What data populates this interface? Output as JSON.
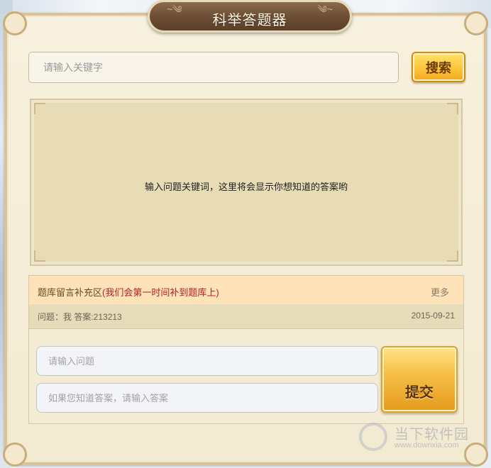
{
  "window": {
    "title": "科举答题器"
  },
  "search": {
    "placeholder": "请输入关键字",
    "button_label": "搜索"
  },
  "answer_panel": {
    "message": "输入问题关键词，这里将会显示你想知道的答案哟"
  },
  "message_board": {
    "title": "题库留言补充区",
    "note": "(我们会第一时间补到题库上)",
    "more_label": "更多",
    "entries": [
      {
        "text": "问题：我 答案:213213",
        "date": "2015-09-21"
      }
    ]
  },
  "submit_form": {
    "question_placeholder": "请输入问题",
    "answer_placeholder": "如果您知道答案，请输入答案",
    "submit_label": "提交"
  },
  "watermark": {
    "name": "当下软件园",
    "url": "www.downxia.com"
  }
}
